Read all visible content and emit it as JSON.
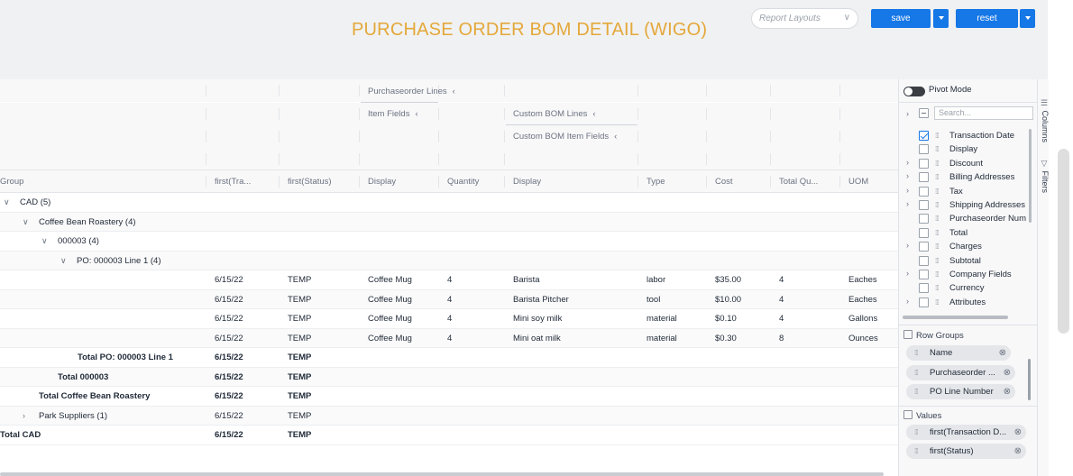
{
  "header": {
    "title": "PURCHASE ORDER BOM DETAIL (WIGO)",
    "report_layouts_placeholder": "Report Layouts",
    "save_label": "save",
    "reset_label": "reset"
  },
  "grid": {
    "group_headers": {
      "purchaseorder_lines": "Purchaseorder Lines",
      "item_fields": "Item Fields",
      "custom_bom_lines": "Custom BOM Lines",
      "custom_bom_item_fields": "Custom BOM Item Fields",
      "collapse_glyph": "‹"
    },
    "columns": [
      "Group",
      "first(Tra...",
      "first(Status)",
      "Display",
      "Quantity",
      "Display",
      "Type",
      "Cost",
      "Total Qu...",
      "UOM"
    ],
    "rows": [
      {
        "group": "CAD (5)",
        "toggle": "∨",
        "indent": 0
      },
      {
        "group": "Coffee Bean Roastery (4)",
        "toggle": "∨",
        "indent": 1
      },
      {
        "group": "000003 (4)",
        "toggle": "∨",
        "indent": 2
      },
      {
        "group": "PO: 000003 Line 1 (4)",
        "toggle": "∨",
        "indent": 3
      },
      {
        "date": "6/15/22",
        "status": "TEMP",
        "item_display": "Coffee Mug",
        "quantity": "4",
        "bom_display": "Barista",
        "type": "labor",
        "cost": "$35.00",
        "total_qty": "4",
        "uom": "Eaches"
      },
      {
        "date": "6/15/22",
        "status": "TEMP",
        "item_display": "Coffee Mug",
        "quantity": "4",
        "bom_display": "Barista Pitcher",
        "type": "tool",
        "cost": "$10.00",
        "total_qty": "4",
        "uom": "Eaches"
      },
      {
        "date": "6/15/22",
        "status": "TEMP",
        "item_display": "Coffee Mug",
        "quantity": "4",
        "bom_display": "Mini soy milk",
        "type": "material",
        "cost": "$0.10",
        "total_qty": "4",
        "uom": "Gallons"
      },
      {
        "date": "6/15/22",
        "status": "TEMP",
        "item_display": "Coffee Mug",
        "quantity": "4",
        "bom_display": "Mini oat milk",
        "type": "material",
        "cost": "$0.30",
        "total_qty": "8",
        "uom": "Ounces"
      },
      {
        "total": "Total PO: 000003 Line 1",
        "date": "6/15/22",
        "status": "TEMP"
      },
      {
        "total": "Total 000003",
        "date": "6/15/22",
        "status": "TEMP"
      },
      {
        "total": "Total Coffee Bean Roastery",
        "date": "6/15/22",
        "status": "TEMP"
      },
      {
        "group": "Park Suppliers (1)",
        "toggle": "›",
        "indent": 1,
        "date": "6/15/22",
        "status": "TEMP"
      },
      {
        "total": "Total CAD",
        "date": "6/15/22",
        "status": "TEMP"
      }
    ]
  },
  "sidebar": {
    "pivot_mode_label": "Pivot Mode",
    "search_placeholder": "Search...",
    "columns_tab": "Columns",
    "filters_tab": "Filters",
    "columns": [
      {
        "label": "Transaction Date",
        "checked": true,
        "expandable": false
      },
      {
        "label": "Display",
        "checked": false,
        "expandable": false
      },
      {
        "label": "Discount",
        "checked": false,
        "expandable": true
      },
      {
        "label": "Billing Addresses",
        "checked": false,
        "expandable": true
      },
      {
        "label": "Tax",
        "checked": false,
        "expandable": true
      },
      {
        "label": "Shipping Addresses",
        "checked": false,
        "expandable": true
      },
      {
        "label": "Purchaseorder Num",
        "checked": false,
        "expandable": false
      },
      {
        "label": "Total",
        "checked": false,
        "expandable": false
      },
      {
        "label": "Charges",
        "checked": false,
        "expandable": true
      },
      {
        "label": "Subtotal",
        "checked": false,
        "expandable": false
      },
      {
        "label": "Company Fields",
        "checked": false,
        "expandable": true
      },
      {
        "label": "Currency",
        "checked": false,
        "expandable": false
      },
      {
        "label": "Attributes",
        "checked": false,
        "expandable": true
      }
    ],
    "row_groups_label": "Row Groups",
    "row_groups": [
      "Name",
      "Purchaseorder ...",
      "PO Line Number"
    ],
    "values_label": "Values",
    "values": [
      "first(Transaction D...",
      "first(Status)"
    ]
  },
  "colors": {
    "accent": "#1677e6",
    "title": "#e4a83a"
  }
}
